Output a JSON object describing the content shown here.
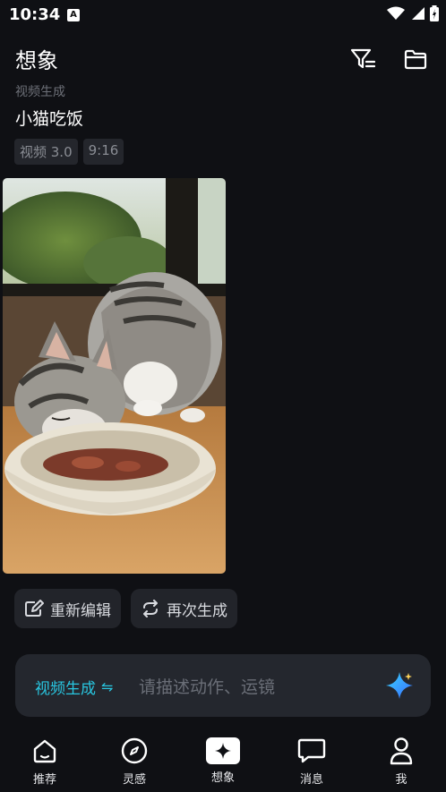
{
  "status": {
    "time": "10:34",
    "notif_letter": "A"
  },
  "header": {
    "title": "想象"
  },
  "item": {
    "crumb": "视频生成",
    "prompt": "小猫吃饭",
    "tags": [
      "视频 3.0",
      "9:16"
    ]
  },
  "actions": {
    "reedit": "重新编辑",
    "regenerate": "再次生成"
  },
  "composer": {
    "mode": "视频生成",
    "placeholder": "请描述动作、运镜"
  },
  "tabs": [
    {
      "label": "推荐"
    },
    {
      "label": "灵感"
    },
    {
      "label": "想象"
    },
    {
      "label": "消息"
    },
    {
      "label": "我"
    }
  ],
  "colors": {
    "accent": "#29c6e0",
    "bg": "#0f1014",
    "chip": "#22242a"
  }
}
